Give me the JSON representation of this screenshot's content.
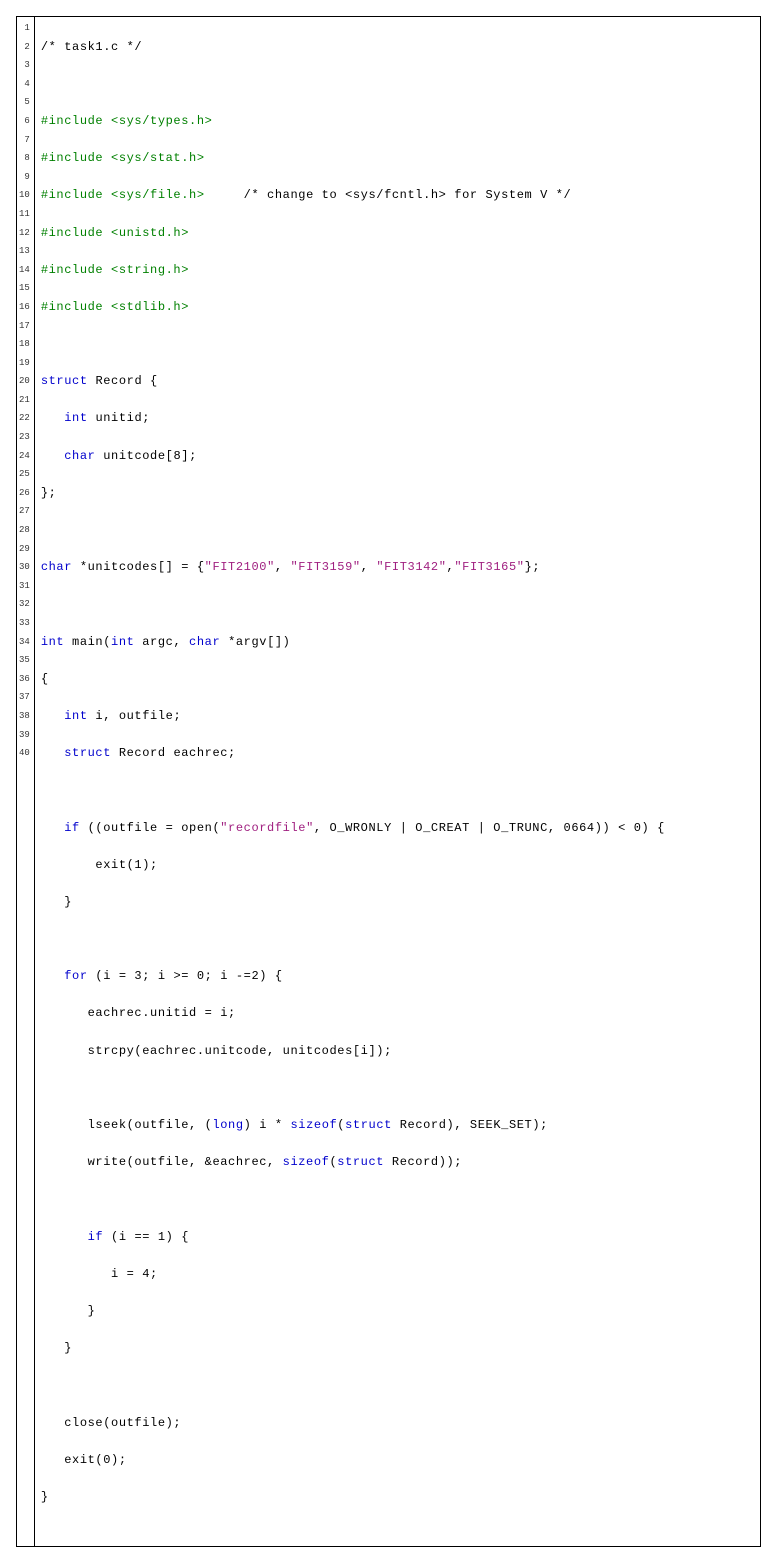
{
  "file_comment": "/* task1.c */",
  "includes": [
    "#include <sys/types.h>",
    "#include <sys/stat.h>",
    "#include <sys/file.h>",
    "#include <unistd.h>",
    "#include <string.h>",
    "#include <stdlib.h>"
  ],
  "include_comment": "/* change to <sys/fcntl.h> for System V */",
  "struct_kw": "struct",
  "struct_name": "Record {",
  "field_int_kw": "int",
  "field_int_name": "unitid;",
  "field_char_kw": "char",
  "field_char_name": "unitcode[8];",
  "struct_close": "};",
  "unitcodes_decl_char": "char",
  "unitcodes_decl_rest": " *unitcodes[] = {",
  "unitcodes": [
    "\"FIT2100\"",
    "\"FIT3159\"",
    "\"FIT3142\"",
    "\"FIT3165\""
  ],
  "unitcodes_close": "};",
  "main_int": "int",
  "main_sig1": " main(",
  "main_sig_int": "int",
  "main_sig2": " argc, ",
  "main_sig_char": "char",
  "main_sig3": " *argv[])",
  "brace_open": "{",
  "decl_int": "int",
  "decl_int_rest": " i, outfile;",
  "decl_struct": "struct",
  "decl_struct_rest": " Record eachrec;",
  "if_kw": "if",
  "if_cond1": " ((outfile = open(",
  "if_str": "\"recordfile\"",
  "if_cond2": ", O_WRONLY | O_CREAT | O_TRUNC, 0664)) < 0) {",
  "exit1": "exit(1);",
  "brace_close": "}",
  "for_kw": "for",
  "for_cond": " (i = 3; i >= 0; i -=2) {",
  "for_l1": "eachrec.unitid = i;",
  "for_l2": "strcpy(eachrec.unitcode, unitcodes[i]);",
  "for_l3_a": "lseek(outfile, (",
  "for_l3_long": "long",
  "for_l3_b": ") i * ",
  "for_l3_sizeof1": "sizeof",
  "for_l3_c": "(",
  "for_l3_struct1": "struct",
  "for_l3_d": " Record), SEEK_SET);",
  "for_l4_a": "write(outfile, &eachrec, ",
  "for_l4_sizeof": "sizeof",
  "for_l4_b": "(",
  "for_l4_struct": "struct",
  "for_l4_c": " Record));",
  "if2_kw": "if",
  "if2_cond": " (i == 1) {",
  "if2_body": "i = 4;",
  "close_call": "close(outfile);",
  "exit0": "exit(0);",
  "line_count": 40
}
